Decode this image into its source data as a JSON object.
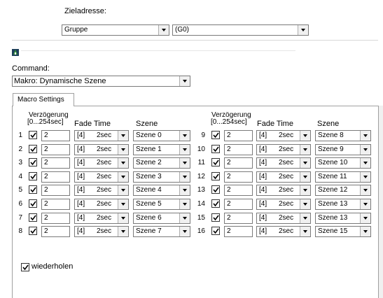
{
  "target": {
    "label": "Zieladresse:",
    "group_value": "Gruppe",
    "address_value": "(G0)"
  },
  "command": {
    "label": "Command:",
    "value": "Makro: Dynamische Szene"
  },
  "macro": {
    "tab_label": "Macro Settings",
    "headers": {
      "delay_line1": "Verzögerung",
      "delay_line2": "[0...254sec]",
      "fade": "Fade Time",
      "scene": "Szene"
    },
    "rows": [
      {
        "num": "1",
        "checked": true,
        "delay": "2",
        "fade_a": "[4]",
        "fade_b": "2sec",
        "scene": "Szene 0"
      },
      {
        "num": "2",
        "checked": true,
        "delay": "2",
        "fade_a": "[4]",
        "fade_b": "2sec",
        "scene": "Szene 1"
      },
      {
        "num": "3",
        "checked": true,
        "delay": "2",
        "fade_a": "[4]",
        "fade_b": "2sec",
        "scene": "Szene 2"
      },
      {
        "num": "4",
        "checked": true,
        "delay": "2",
        "fade_a": "[4]",
        "fade_b": "2sec",
        "scene": "Szene 3"
      },
      {
        "num": "5",
        "checked": true,
        "delay": "2",
        "fade_a": "[4]",
        "fade_b": "2sec",
        "scene": "Szene 4"
      },
      {
        "num": "6",
        "checked": true,
        "delay": "2",
        "fade_a": "[4]",
        "fade_b": "2sec",
        "scene": "Szene 5"
      },
      {
        "num": "7",
        "checked": true,
        "delay": "2",
        "fade_a": "[4]",
        "fade_b": "2sec",
        "scene": "Szene 6"
      },
      {
        "num": "8",
        "checked": true,
        "delay": "2",
        "fade_a": "[4]",
        "fade_b": "2sec",
        "scene": "Szene 7"
      },
      {
        "num": "9",
        "checked": true,
        "delay": "2",
        "fade_a": "[4]",
        "fade_b": "2sec",
        "scene": "Szene 8"
      },
      {
        "num": "10",
        "checked": true,
        "delay": "2",
        "fade_a": "[4]",
        "fade_b": "2sec",
        "scene": "Szene 9"
      },
      {
        "num": "11",
        "checked": true,
        "delay": "2",
        "fade_a": "[4]",
        "fade_b": "2sec",
        "scene": "Szene 10"
      },
      {
        "num": "12",
        "checked": true,
        "delay": "2",
        "fade_a": "[4]",
        "fade_b": "2sec",
        "scene": "Szene 11"
      },
      {
        "num": "13",
        "checked": true,
        "delay": "2",
        "fade_a": "[4]",
        "fade_b": "2sec",
        "scene": "Szene 12"
      },
      {
        "num": "14",
        "checked": true,
        "delay": "2",
        "fade_a": "[4]",
        "fade_b": "2sec",
        "scene": "Szene 13"
      },
      {
        "num": "15",
        "checked": true,
        "delay": "2",
        "fade_a": "[4]",
        "fade_b": "2sec",
        "scene": "Szene 13"
      },
      {
        "num": "16",
        "checked": true,
        "delay": "2",
        "fade_a": "[4]",
        "fade_b": "2sec",
        "scene": "Szene 15"
      }
    ],
    "repeat_label": "wiederholen",
    "repeat_checked": true
  },
  "icons": {
    "app_icon": "dali-device-icon"
  }
}
